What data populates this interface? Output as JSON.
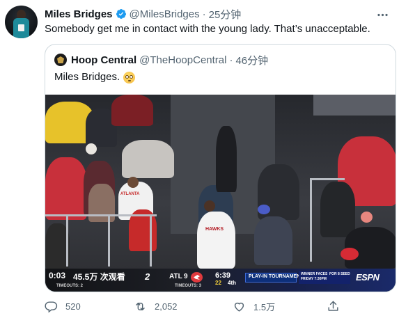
{
  "tweet": {
    "author_name": "Miles Bridges",
    "author_handle": "@MilesBridges",
    "separator": "·",
    "timestamp": "25分钟",
    "verified": true,
    "text": "Somebody get me in contact with the young lady. That’s unacceptable.",
    "more_icon": "more-dots-icon"
  },
  "quoted_tweet": {
    "author_name": "Hoop Central",
    "author_handle": "@TheHoopCentral",
    "separator": "·",
    "timestamp": "46分钟",
    "text": "Miles Bridges.",
    "emoji": "flushed-face-emoji",
    "video": {
      "elapsed": "0:03",
      "views": "45.5万 次观看",
      "scoreboard": {
        "away_score": "2",
        "home_team": "ATL",
        "home_score": "9",
        "timeouts_left": "TIMEOUTS: 2",
        "timeouts_right": "TIMEOUTS: 3",
        "game_clock": "6:39",
        "shot_clock": "22",
        "quarter": "4th",
        "event": "PLAY-IN TOURNAMENT",
        "matchup_line1": "WINNER FACES",
        "matchup_line2": "FOR 8 SEED",
        "matchup_date": "FRIDAY 7:30PM",
        "network": "ESPN",
        "jersey_text": "ATLANTA",
        "player_jersey": "HAWKS"
      }
    }
  },
  "actions": {
    "reply_count": "520",
    "retweet_count": "2,052",
    "like_count": "1.5万",
    "reply_icon": "reply-icon",
    "retweet_icon": "retweet-icon",
    "like_icon": "heart-icon",
    "share_icon": "share-icon"
  },
  "colors": {
    "text_primary": "#0f1419",
    "text_secondary": "#536471",
    "verified_blue": "#1d9bf0",
    "border": "#cfd9de"
  }
}
